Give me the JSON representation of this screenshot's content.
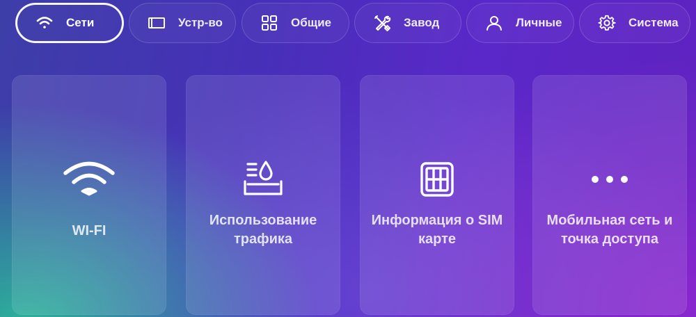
{
  "tabs": [
    {
      "id": "network",
      "label": "Сети",
      "icon": "wifi-icon",
      "active": true
    },
    {
      "id": "device",
      "label": "Устр-во",
      "icon": "screen-icon",
      "active": false
    },
    {
      "id": "general",
      "label": "Общие",
      "icon": "grid-icon",
      "active": false
    },
    {
      "id": "factory",
      "label": "Завод",
      "icon": "tools-icon",
      "active": false
    },
    {
      "id": "personal",
      "label": "Личные",
      "icon": "user-icon",
      "active": false
    },
    {
      "id": "system",
      "label": "Система",
      "icon": "gear-icon",
      "active": false
    }
  ],
  "cards": [
    {
      "id": "wifi",
      "label": "WI-FI",
      "icon": "wifi-icon"
    },
    {
      "id": "traffic",
      "label": "Использование трафика",
      "icon": "data-usage-icon"
    },
    {
      "id": "sim",
      "label": "Информация о SIM карте",
      "icon": "sim-card-icon"
    },
    {
      "id": "mobile",
      "label": "Мобильная сеть и точка доступа",
      "icon": "more-dots-icon"
    }
  ]
}
